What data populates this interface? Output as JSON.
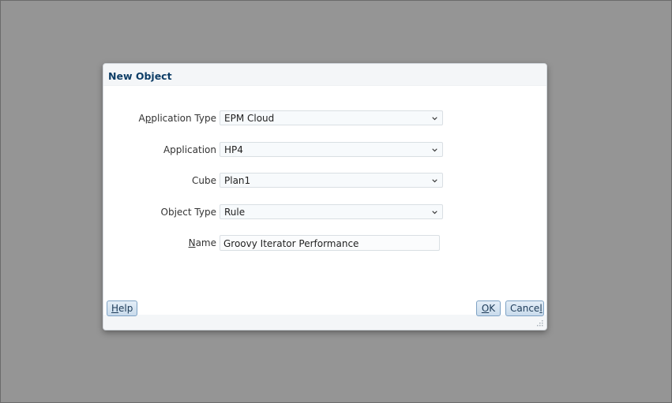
{
  "dialog": {
    "title": "New Object"
  },
  "form": {
    "application_type": {
      "label": "Application Type",
      "value": "EPM Cloud"
    },
    "application": {
      "label": "Application",
      "value": "HP4"
    },
    "cube": {
      "label": "Cube",
      "value": "Plan1"
    },
    "object_type": {
      "label": "Object Type",
      "value": "Rule"
    },
    "name": {
      "label": "Name",
      "value": "Groovy Iterator Performance"
    }
  },
  "buttons": {
    "help": "Help",
    "ok": "OK",
    "cancel": "Cancel"
  },
  "icons": {
    "dropdown": "chevron-down-icon",
    "resize": "resize-grip-icon"
  },
  "colors": {
    "overlay": "#959595",
    "title": "#0e3e67",
    "button_border": "#7ea2c4"
  }
}
